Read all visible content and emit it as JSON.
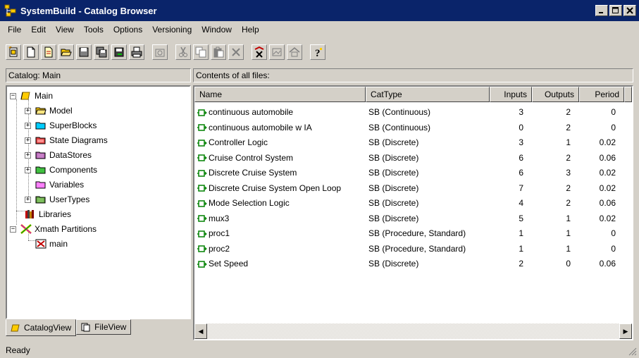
{
  "window": {
    "title": "SystemBuild - Catalog Browser",
    "controls": [
      "minimize-icon",
      "maximize-icon",
      "close-icon"
    ]
  },
  "menu": [
    "File",
    "Edit",
    "View",
    "Tools",
    "Options",
    "Versioning",
    "Window",
    "Help"
  ],
  "toolbar": {
    "buttons": [
      "new-catalog-icon",
      "new-file-icon",
      "new-item-icon",
      "open-folder-icon",
      "save-icon",
      "save-all-icon",
      "save-as-icon",
      "print-icon",
      "properties-icon",
      "cut-icon",
      "copy-icon",
      "paste-icon",
      "delete-icon",
      "partition-icon",
      "image-icon",
      "home-icon",
      "help-icon"
    ]
  },
  "left_pane": {
    "header": "Catalog: Main",
    "tree": [
      {
        "label": "Main",
        "level": 0,
        "expander": "−",
        "icon": "catalog-icon"
      },
      {
        "label": "Model",
        "level": 1,
        "expander": "+",
        "icon": "model-folder-icon"
      },
      {
        "label": "SuperBlocks",
        "level": 1,
        "expander": "+",
        "icon": "superblocks-folder-icon"
      },
      {
        "label": "State Diagrams",
        "level": 1,
        "expander": "+",
        "icon": "state-diagrams-folder-icon"
      },
      {
        "label": "DataStores",
        "level": 1,
        "expander": "+",
        "icon": "datastores-folder-icon"
      },
      {
        "label": "Components",
        "level": 1,
        "expander": "+",
        "icon": "components-folder-icon"
      },
      {
        "label": "Variables",
        "level": 1,
        "expander": "",
        "icon": "variables-folder-icon"
      },
      {
        "label": "UserTypes",
        "level": 1,
        "expander": "+",
        "icon": "usertypes-folder-icon"
      },
      {
        "label": "Libraries",
        "level": 0,
        "expander": "",
        "icon": "libraries-icon"
      },
      {
        "label": "Xmath Partitions",
        "level": 0,
        "expander": "−",
        "icon": "xmath-icon"
      },
      {
        "label": "main",
        "level": 1,
        "expander": "",
        "icon": "partition-icon"
      }
    ],
    "tabs": [
      {
        "label": "CatalogView",
        "icon": "catalog-icon"
      },
      {
        "label": "FileView",
        "icon": "file-icon"
      }
    ]
  },
  "right_pane": {
    "header": "Contents of all files:",
    "columns": [
      "Name",
      "CatType",
      "Inputs",
      "Outputs",
      "Period"
    ],
    "rows": [
      [
        "continuous automobile",
        "SB (Continuous)",
        "3",
        "2",
        "0"
      ],
      [
        "continuous automobile w IA",
        "SB (Continuous)",
        "0",
        "2",
        "0"
      ],
      [
        "Controller Logic",
        "SB (Discrete)",
        "3",
        "1",
        "0.02"
      ],
      [
        "Cruise Control System",
        "SB (Discrete)",
        "6",
        "2",
        "0.06"
      ],
      [
        "Discrete Cruise System",
        "SB (Discrete)",
        "6",
        "3",
        "0.02"
      ],
      [
        "Discrete Cruise System Open Loop",
        "SB (Discrete)",
        "7",
        "2",
        "0.02"
      ],
      [
        "Mode Selection Logic",
        "SB (Discrete)",
        "4",
        "2",
        "0.06"
      ],
      [
        "mux3",
        "SB (Discrete)",
        "5",
        "1",
        "0.02"
      ],
      [
        "proc1",
        "SB (Procedure, Standard)",
        "1",
        "1",
        "0"
      ],
      [
        "proc2",
        "SB (Procedure, Standard)",
        "1",
        "1",
        "0"
      ],
      [
        "Set Speed",
        "SB (Discrete)",
        "2",
        "0",
        "0.06"
      ]
    ]
  },
  "status": {
    "text": "Ready"
  },
  "colors": {
    "titlebar": "#0a246a",
    "face": "#d4d0c8",
    "superblock_icon": "#008000"
  }
}
